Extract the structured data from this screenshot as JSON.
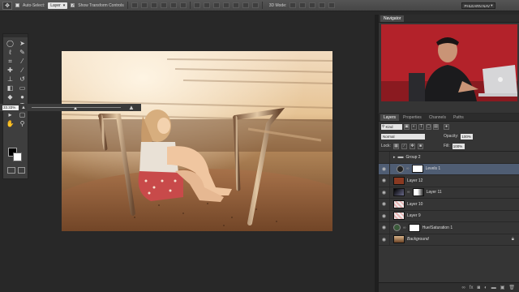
{
  "options_bar": {
    "auto_select_label": "Auto-Select:",
    "auto_select_value": "Layer",
    "show_transform_label": "Show Transform Controls",
    "mode_label": "3D Mode:",
    "workspace": "PHLEARN NAV"
  },
  "navigator": {
    "tab": "Navigator",
    "zoom": "33.33%"
  },
  "layers_panel": {
    "tabs": [
      "Layers",
      "Properties",
      "Channels",
      "Paths"
    ],
    "filter_kind": "Kind",
    "blend_mode": "Normal",
    "opacity_label": "Opacity:",
    "opacity_value": "100%",
    "lock_label": "Lock:",
    "fill_label": "Fill:",
    "fill_value": "100%",
    "layers": [
      {
        "name": "Group 2"
      },
      {
        "name": "Levels 1"
      },
      {
        "name": "Layer 12"
      },
      {
        "name": "Layer 11"
      },
      {
        "name": "Layer 10"
      },
      {
        "name": "Layer 9"
      },
      {
        "name": "Hue/Saturation 1"
      },
      {
        "name": "Background"
      }
    ]
  },
  "colors": {
    "selected_layer": "#4f5d73",
    "layer12_thumb": "#8a3a22",
    "nav_bg_red": "#b3222a"
  }
}
